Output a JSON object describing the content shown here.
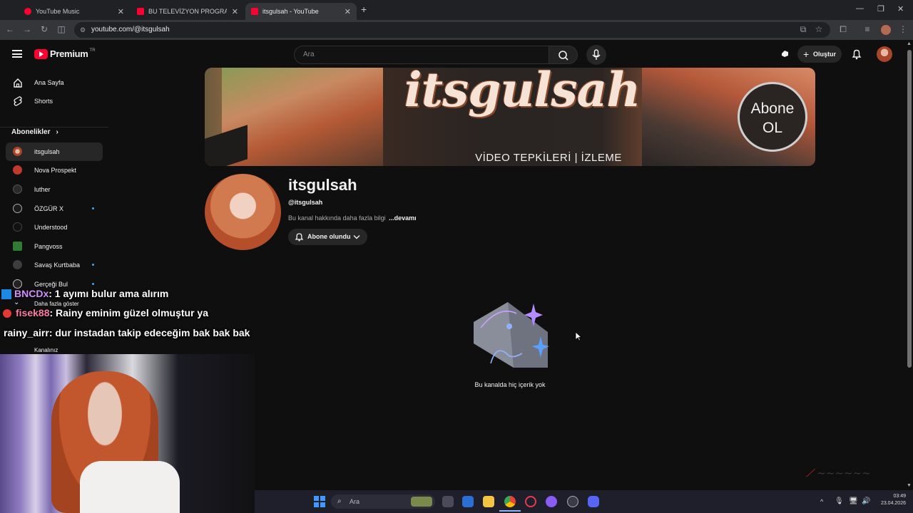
{
  "browser": {
    "tabs": [
      {
        "label": "YouTube Music"
      },
      {
        "label": "BU TELEVİZYON PROGRAM NA"
      },
      {
        "label": "itsgulsah - YouTube"
      }
    ],
    "url": "youtube.com/@itsgulsah"
  },
  "header": {
    "logo": "Premium",
    "region": "TR",
    "search_placeholder": "Ara",
    "create_label": "Oluştur"
  },
  "sidebar": {
    "home": "Ana Sayfa",
    "shorts": "Shorts",
    "subscriptions_title": "Abonelikler",
    "channels": [
      {
        "label": "itsgulsah"
      },
      {
        "label": "Nova Prospekt"
      },
      {
        "label": "luther"
      },
      {
        "label": "ÖZGÜR X"
      },
      {
        "label": "Understood"
      },
      {
        "label": "Pangvoss"
      },
      {
        "label": "Savaş Kurtbaba"
      },
      {
        "label": "Gerçeği Bul"
      }
    ],
    "show_more": "Daha fazla göster",
    "your_channel": "Kanalınız"
  },
  "banner": {
    "title": "itsgulsah",
    "subtitle": "VİDEO TEPKİLERİ | İZLEME",
    "badge_line1": "Abone",
    "badge_line2": "OL"
  },
  "channel": {
    "name": "itsgulsah",
    "handle": "@itsgulsah",
    "about": "Bu kanal hakkında daha fazla bilgi",
    "more": "...devamı",
    "subscribed_label": "Abone olundu"
  },
  "empty_state": {
    "message": "Bu kanalda hiç içerik yok"
  },
  "chat": [
    {
      "user": "BNCDx",
      "message": ": 1 ayımı bulur ama alırım",
      "color": "#d58cff"
    },
    {
      "user": "fisek88",
      "message": ": Rainy eminim güzel olmuştur ya",
      "color": "#ff7aa8"
    },
    {
      "user": "rainy_airr",
      "message": ": dur instadan takip edeceğim bak bak bak",
      "color": "#ffffff"
    }
  ],
  "taskbar": {
    "search_placeholder": "Ara",
    "time": "03:49",
    "date": "23.04.2026"
  },
  "colors": {
    "youtube_red": "#ff0033",
    "background": "#0f0f0f",
    "accent_blue": "#3ea6ff"
  }
}
